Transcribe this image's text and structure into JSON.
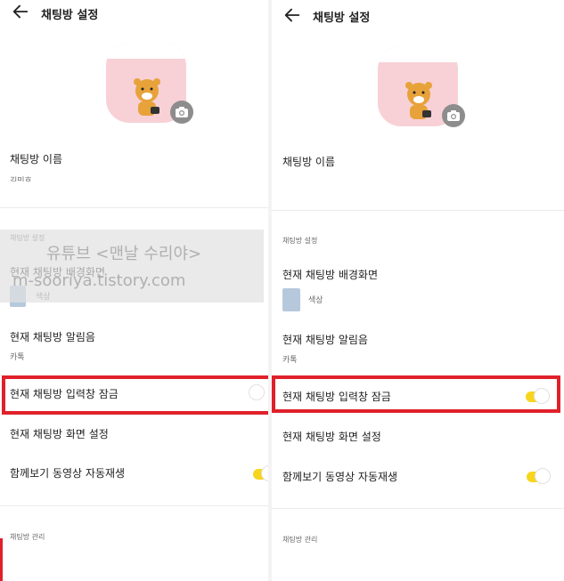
{
  "title": "채팅방 설정",
  "chatroom_name_label": "채팅방 이름",
  "chatroom_name_value": "김민호",
  "section_settings": "채팅방 설정",
  "background_label": "현재 채팅방 배경화면",
  "background_value": "색상",
  "alert_label": "현재 채팅방 알림음",
  "alert_value": "카톡",
  "input_lock_label": "현재 채팅방 입력창 잠금",
  "screen_settings_label": "현재 채팅방 화면 설정",
  "autoplay_label": "함께보기 동영상 자동재생",
  "section_manage": "채팅방 관리",
  "watermark_line1": "유튜브 <맨날 수리야>",
  "watermark_line2": "m-sooriya.tistory.com",
  "left_panel": {
    "input_lock_on": false,
    "autoplay_on": true
  },
  "right_panel": {
    "input_lock_on": true,
    "autoplay_on": true
  },
  "colors": {
    "toggle_on": "#f7d51c",
    "highlight": "#e0202a",
    "avatar_bg": "#f8d1d6",
    "swatch": "#b6c8dc"
  },
  "icons": {
    "back": "back-arrow-icon",
    "camera": "camera-icon",
    "avatar": "ryan-character-icon"
  }
}
